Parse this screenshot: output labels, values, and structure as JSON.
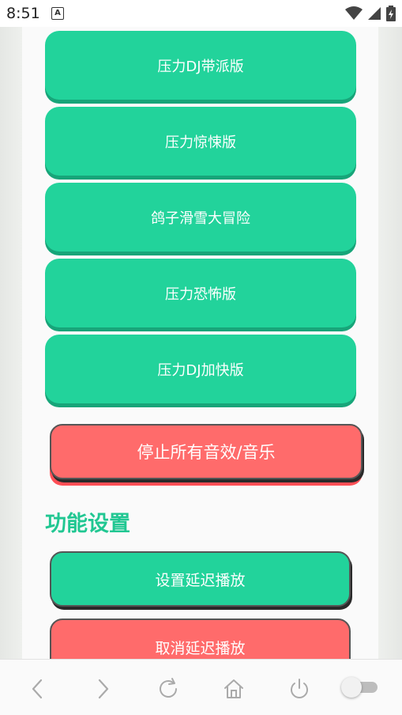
{
  "status_bar": {
    "time": "8:51",
    "notification_glyph": "A"
  },
  "sound_buttons": [
    {
      "label": "压力DJ带派版"
    },
    {
      "label": "压力惊悚版"
    },
    {
      "label": "鸽子滑雪大冒险"
    },
    {
      "label": "压力恐怖版"
    },
    {
      "label": "压力DJ加快版"
    }
  ],
  "stop_all": {
    "label": "停止所有音效/音乐"
  },
  "settings": {
    "title": "功能设置",
    "set_delay_label": "设置延迟播放",
    "cancel_delay_label": "取消延迟播放"
  },
  "colors": {
    "accent_green": "#22d39b",
    "accent_red": "#ff6b6b"
  },
  "icons": {
    "back": "chevron-left-icon",
    "forward": "chevron-right-icon",
    "reload": "reload-icon",
    "home": "home-icon",
    "power": "power-icon",
    "toggle": "toggle-switch"
  }
}
